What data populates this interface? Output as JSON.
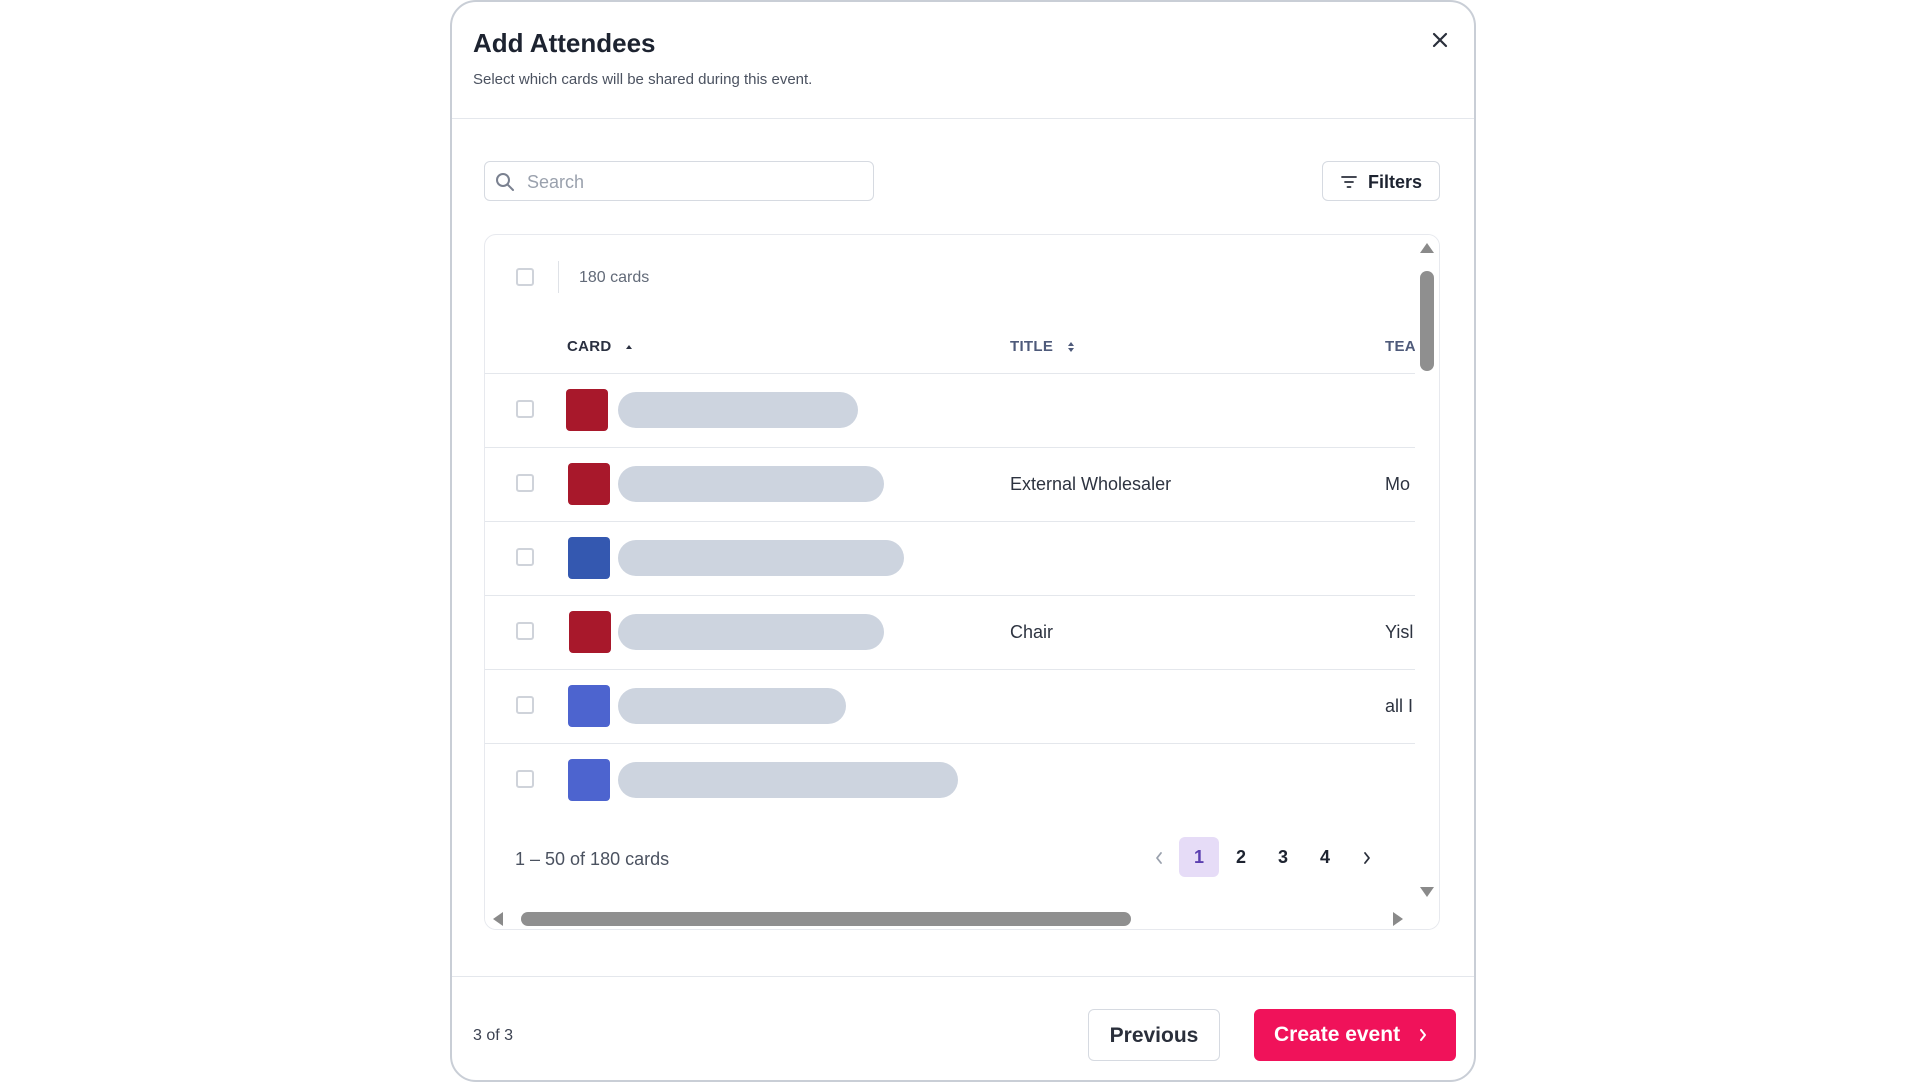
{
  "modal": {
    "title": "Add Attendees",
    "subtitle": "Select which cards will be shared during this event."
  },
  "search": {
    "placeholder": "Search",
    "value": ""
  },
  "filters": {
    "label": "Filters"
  },
  "table": {
    "count_label": "180 cards",
    "columns": {
      "card": "CARD",
      "title": "TITLE",
      "team": "TEA"
    },
    "rows": [
      {
        "avatar_color": "#a8182b",
        "title": "",
        "team": ""
      },
      {
        "avatar_color": "#a8182b",
        "title": "External Wholesaler",
        "team": "Mo"
      },
      {
        "avatar_color": "#3458b0",
        "title": "",
        "team": ""
      },
      {
        "avatar_color": "#a8182b",
        "title": "Chair",
        "team": "Yisl"
      },
      {
        "avatar_color": "#4d64cf",
        "title": "",
        "team": "all I"
      },
      {
        "avatar_color": "#4d64cf",
        "title": "",
        "team": ""
      }
    ],
    "range_label": "1 – 50 of 180 cards",
    "pages": [
      "1",
      "2",
      "3",
      "4"
    ],
    "current_page": "1"
  },
  "footer": {
    "step": "3 of 3",
    "previous_label": "Previous",
    "create_label": "Create event"
  },
  "colors": {
    "accent": "#f0125a",
    "active_page_bg": "#e6dcf7",
    "redacted": "#cdd4df"
  }
}
